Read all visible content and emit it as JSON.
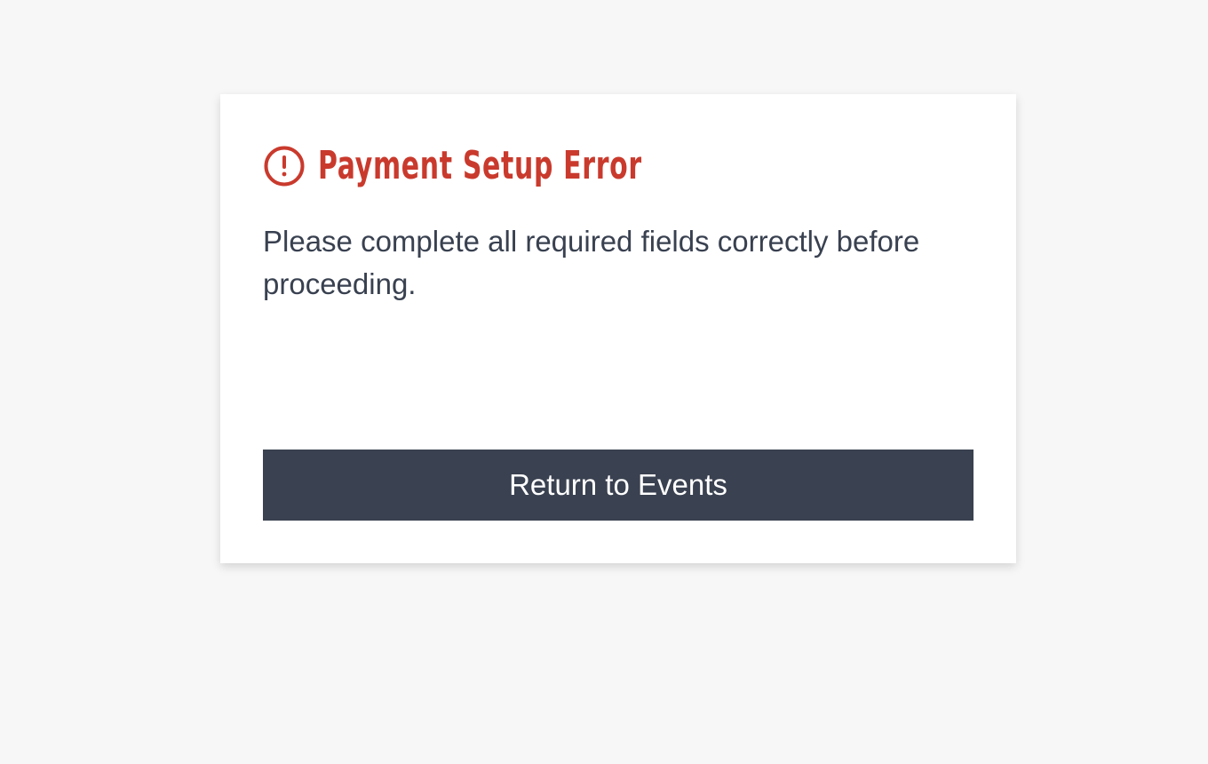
{
  "dialog": {
    "title": "Payment Setup Error",
    "icon": "alert-circle-icon",
    "message": "Please complete all required fields correctly before proceeding.",
    "button_label": "Return to Events"
  },
  "colors": {
    "background": "#f7f7f7",
    "card": "#ffffff",
    "error": "#c93a2d",
    "text": "#394150",
    "button": "#3a4150",
    "button_text": "#ffffff"
  }
}
